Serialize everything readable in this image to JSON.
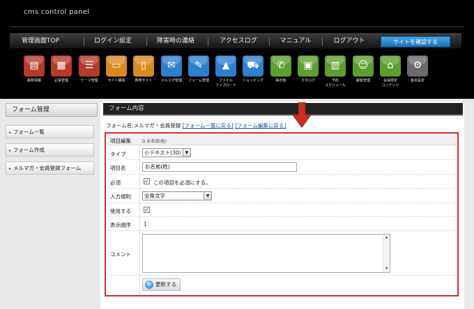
{
  "app": {
    "brand": "cms control panel"
  },
  "nav": {
    "items": [
      "管理画面TOP",
      "ログイン設定",
      "障害時の連絡",
      "アクセスログ",
      "マニュアル",
      "ログアウト"
    ],
    "site_button": "サイトを確認する"
  },
  "toolbar": {
    "items": [
      {
        "label": "最新情報",
        "color": "#b53a2c",
        "icon": "newspaper-icon",
        "glyph": "▤"
      },
      {
        "label": "記事管理",
        "color": "#b53a2c",
        "icon": "articles-icon",
        "glyph": "▦"
      },
      {
        "label": "テーマ管理",
        "color": "#b53a2c",
        "icon": "list-icon",
        "glyph": "☰"
      },
      {
        "label": "サイト構成",
        "color": "#d98a1e",
        "icon": "monitor-icon",
        "glyph": "▭"
      },
      {
        "label": "携帯サイト",
        "color": "#d98a1e",
        "icon": "mobile-icon",
        "glyph": "▯"
      },
      {
        "label": "メルマガ管理",
        "color": "#2f7fcf",
        "icon": "envelope-icon",
        "glyph": "✉"
      },
      {
        "label": "フォーム管理",
        "color": "#2f7fcf",
        "icon": "form-icon",
        "glyph": "✎"
      },
      {
        "label": "ファイル\nアップロード",
        "color": "#2f7fcf",
        "icon": "file-upload-icon",
        "glyph": "▲"
      },
      {
        "label": "ショッピング",
        "color": "#2f7fcf",
        "icon": "cart-icon",
        "glyph": "⛟"
      },
      {
        "label": "掲示板",
        "color": "#5c9e2f",
        "icon": "chat-icon",
        "glyph": "✆"
      },
      {
        "label": "カタログ",
        "color": "#5c9e2f",
        "icon": "catalog-icon",
        "glyph": "▣"
      },
      {
        "label": "予約\nスケジュール",
        "color": "#5c9e2f",
        "icon": "calendar-icon",
        "glyph": "▥"
      },
      {
        "label": "顧客管理",
        "color": "#5c9e2f",
        "icon": "customers-icon",
        "glyph": "☺"
      },
      {
        "label": "会員限定\nコンテンツ",
        "color": "#5c9e2f",
        "icon": "lock-icon",
        "glyph": "⌂"
      },
      {
        "label": "基本設定",
        "color": "#6a6a6a",
        "icon": "gear-icon",
        "glyph": "⚙"
      }
    ]
  },
  "sidebar": {
    "title": "フォーム管理",
    "items": [
      "フォーム一覧",
      "フォーム作成",
      "メルマガ・会員登録フォーム"
    ]
  },
  "main": {
    "title": "フォーム内容",
    "form_name_label": "フォーム名:メルマガ・会員登録",
    "link_form_list": "[フォーム一覧に戻る]",
    "link_form_edit": "[フォーム編集に戻る]"
  },
  "edit": {
    "header": "項目編集",
    "header_sub": "D お名前(姓)",
    "type_label": "タイプ",
    "type_value": "小テキスト(30)",
    "name_label": "項目名",
    "name_value": "お名前(姓)",
    "required_label": "必須",
    "required_text": "この項目を必須にする。",
    "rule_label": "入力規則",
    "rule_value": "全角文字",
    "use_label": "使用する",
    "order_label": "表示順序",
    "order_value": "1",
    "comment_label": "コメント",
    "update_button": "更新する"
  },
  "colors": {
    "highlight_border": "#d52a2a",
    "arrow": "#c8321c",
    "link": "#1d4fa8",
    "site_button": "#2a86d0"
  }
}
